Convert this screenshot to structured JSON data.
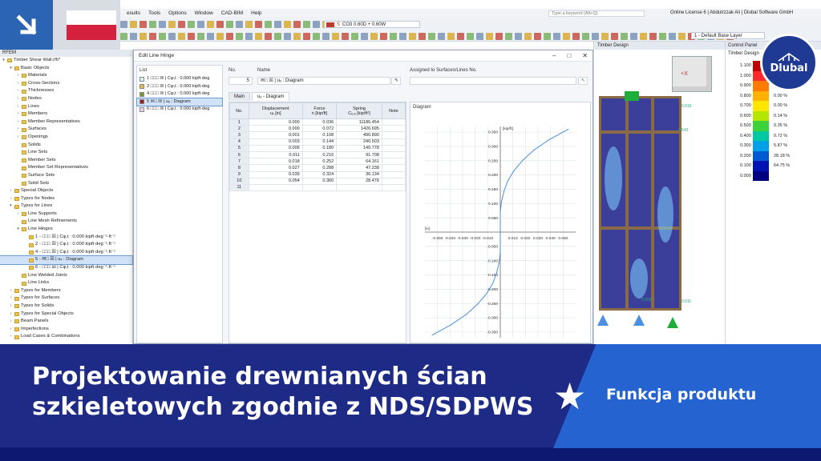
{
  "menu": [
    "esults",
    "Tools",
    "Options",
    "Window",
    "CAD-BIM",
    "Help"
  ],
  "search_placeholder": "Type a keyword (Alt+Q)",
  "license": "Online License 6 | Abdulrzzak Ali | Dlubal Software GmbH",
  "toolbar": {
    "combo": "CO3  0.60D + 0.60W",
    "combo_tag": "S",
    "layer": "1 - Default Base Layer"
  },
  "navigator": {
    "title": "RFEM",
    "items": [
      {
        "label": "Timber Shear Wall.rf6*",
        "indent": 0,
        "exp": "▾"
      },
      {
        "label": "Basic Objects",
        "indent": 1,
        "exp": "▾"
      },
      {
        "label": "Materials",
        "indent": 2,
        "exp": "›"
      },
      {
        "label": "Cross-Sections",
        "indent": 2,
        "exp": "›"
      },
      {
        "label": "Thicknesses",
        "indent": 2,
        "exp": "›"
      },
      {
        "label": "Nodes",
        "indent": 2,
        "exp": "›"
      },
      {
        "label": "Lines",
        "indent": 2,
        "exp": "›"
      },
      {
        "label": "Members",
        "indent": 2,
        "exp": "›"
      },
      {
        "label": "Member Representatives",
        "indent": 2,
        "exp": "›"
      },
      {
        "label": "Surfaces",
        "indent": 2,
        "exp": "›"
      },
      {
        "label": "Openings",
        "indent": 2,
        "exp": "›"
      },
      {
        "label": "Solids",
        "indent": 2,
        "exp": ""
      },
      {
        "label": "Line Sets",
        "indent": 2,
        "exp": ""
      },
      {
        "label": "Member Sets",
        "indent": 2,
        "exp": ""
      },
      {
        "label": "Member Set Representatives",
        "indent": 2,
        "exp": ""
      },
      {
        "label": "Surface Sets",
        "indent": 2,
        "exp": ""
      },
      {
        "label": "Solid Sets",
        "indent": 2,
        "exp": ""
      },
      {
        "label": "Special Objects",
        "indent": 1,
        "exp": "›"
      },
      {
        "label": "Types for Nodes",
        "indent": 1,
        "exp": "›"
      },
      {
        "label": "Types for Lines",
        "indent": 1,
        "exp": "▾"
      },
      {
        "label": "Line Supports",
        "indent": 2,
        "exp": "›"
      },
      {
        "label": "Line Mesh Refinements",
        "indent": 2,
        "exp": ""
      },
      {
        "label": "Line Hinges",
        "indent": 2,
        "exp": "▾"
      },
      {
        "label": "1 - □□□ ☒ | Cφ,t : 0.000 kipft·deg⁻¹·ft⁻¹",
        "indent": 3,
        "exp": ""
      },
      {
        "label": "2 - □□□ ☒ | Cφ,t : 0.000 kipft·deg⁻¹·ft⁻¹",
        "indent": 3,
        "exp": ""
      },
      {
        "label": "4 - □□□ ☒ | Cφ,t : 0.000 kipft·deg⁻¹·ft⁻¹",
        "indent": 3,
        "exp": ""
      },
      {
        "label": "5 - ✉□ ☒ | uₓ : Diagram",
        "indent": 3,
        "exp": "",
        "sel": true
      },
      {
        "label": "6 - □□□ ☒ | Cφ,t : 0.000 kipft·deg⁻¹·ft⁻¹",
        "indent": 3,
        "exp": ""
      },
      {
        "label": "Line Welded Joints",
        "indent": 2,
        "exp": ""
      },
      {
        "label": "Line Links",
        "indent": 2,
        "exp": ""
      },
      {
        "label": "Types for Members",
        "indent": 1,
        "exp": "›"
      },
      {
        "label": "Types for Surfaces",
        "indent": 1,
        "exp": "›"
      },
      {
        "label": "Types for Solids",
        "indent": 1,
        "exp": "›"
      },
      {
        "label": "Types for Special Objects",
        "indent": 1,
        "exp": "›"
      },
      {
        "label": "Beam Panels",
        "indent": 1,
        "exp": "›"
      },
      {
        "label": "Imperfections",
        "indent": 1,
        "exp": "›"
      },
      {
        "label": "Load Cases & Combinations",
        "indent": 1,
        "exp": "›"
      }
    ]
  },
  "dialog": {
    "title": "Edit Line Hinge",
    "list_label": "List",
    "list": [
      {
        "text": "1 □□□ ☒ | Cφ,t : 0.000 kipft·deg",
        "color": "#d9f3f3"
      },
      {
        "text": "2 □□□ ☒ | Cφ,t : 0.000 kipft·deg",
        "color": "#e8b64a"
      },
      {
        "text": "4 □□□ ☒ | Cφ,t : 0.000 kipft·deg",
        "color": "#7a9a2a"
      },
      {
        "text": "5 ✉□ ☒ | uₓ : Diagram",
        "color": "#9b1c1c",
        "sel": true
      },
      {
        "text": "6 □□□ ☒ | Cφ,t : 0.000 kipft·deg",
        "color": "#e8d2f0"
      }
    ],
    "no_label": "No.",
    "no_value": "5",
    "name_label": "Name",
    "name_value": "✉□ ☒ | uₓ : Diagram",
    "assigned_label": "Assigned to Surfaces/Lines No.",
    "tabs": [
      "Main",
      "uₓ - Diagram"
    ],
    "table_headers": [
      "No.",
      "Displacement\nuₓ [in]",
      "Force\nn [kip/ft]",
      "Spring\nCᵤ,ₓ [kip/ft²]",
      "Note"
    ],
    "rows": [
      [
        "1",
        "0.000",
        "0.036",
        "11186.454",
        ""
      ],
      [
        "2",
        "0.000",
        "0.072",
        "1426.695",
        ""
      ],
      [
        "3",
        "0.001",
        "0.108",
        "490.890",
        ""
      ],
      [
        "4",
        "0.003",
        "0.144",
        "240.503",
        ""
      ],
      [
        "5",
        "0.006",
        "0.180",
        "140.778",
        ""
      ],
      [
        "6",
        "0.011",
        "0.216",
        "91.708",
        ""
      ],
      [
        "7",
        "0.018",
        "0.252",
        "64.161",
        ""
      ],
      [
        "8",
        "0.027",
        "0.288",
        "47.238",
        ""
      ],
      [
        "9",
        "0.039",
        "0.324",
        "36.134",
        ""
      ],
      [
        "10",
        "0.054",
        "0.360",
        "28.476",
        ""
      ],
      [
        "11",
        "",
        "",
        "",
        ""
      ]
    ],
    "diagram_label": "Diagram"
  },
  "chart_data": {
    "type": "line",
    "title": "",
    "xlabel": "[in]",
    "ylabel": "[kip/ft]",
    "x_ticks": [
      "-0.050",
      "-0.040",
      "-0.030",
      "-0.020",
      "-0.010",
      "0.010",
      "0.020",
      "0.030",
      "0.040",
      "0.050"
    ],
    "y_ticks": [
      "0.350",
      "0.300",
      "0.250",
      "0.200",
      "0.150",
      "0.100",
      "0.050",
      "-0.050",
      "-0.100",
      "-0.150",
      "-0.200",
      "-0.250",
      "-0.300",
      "-0.350"
    ],
    "xlim": [
      -0.06,
      0.06
    ],
    "ylim": [
      -0.37,
      0.37
    ],
    "series": [
      {
        "x": [
          -0.054,
          -0.039,
          -0.027,
          -0.018,
          -0.011,
          -0.006,
          -0.003,
          -0.001,
          0.0,
          0.0,
          0.0,
          0.0,
          0.0,
          0.001,
          0.003,
          0.006,
          0.011,
          0.018,
          0.027,
          0.039,
          0.054
        ],
        "y": [
          -0.36,
          -0.324,
          -0.288,
          -0.252,
          -0.216,
          -0.18,
          -0.144,
          -0.108,
          -0.072,
          -0.036,
          0.0,
          0.036,
          0.072,
          0.108,
          0.144,
          0.18,
          0.216,
          0.252,
          0.288,
          0.324,
          0.36
        ],
        "color": "#4a90d9"
      }
    ]
  },
  "viewport": {
    "title": "Timber Design",
    "labels": [
      "0.016",
      "0.542",
      "0.006",
      "0.011"
    ]
  },
  "control_panel": {
    "title": "Control Panel",
    "subtitle": "Timber Design",
    "legend": [
      {
        "val": "1.100",
        "color": "#c00000",
        "pct": ""
      },
      {
        "val": "1.000",
        "color": "#ff2a2a",
        "pct": "0.00 %"
      },
      {
        "val": "0.900",
        "color": "#ff7a00",
        "pct": "0.00 %"
      },
      {
        "val": "0.800",
        "color": "#ffb300",
        "pct": "0.00 %"
      },
      {
        "val": "0.700",
        "color": "#ffe600",
        "pct": "0.00 %"
      },
      {
        "val": "0.600",
        "color": "#b4e600",
        "pct": "0.14 %"
      },
      {
        "val": "0.500",
        "color": "#3cd23c",
        "pct": "0.35 %"
      },
      {
        "val": "0.400",
        "color": "#00c8a0",
        "pct": "0.72 %"
      },
      {
        "val": "0.300",
        "color": "#00a0e6",
        "pct": "5.87 %"
      },
      {
        "val": "0.200",
        "color": "#005ad2",
        "pct": "28.18 %"
      },
      {
        "val": "0.100",
        "color": "#0014b4",
        "pct": "64.75 %"
      },
      {
        "val": "0.000",
        "color": "#000080",
        "pct": ""
      }
    ]
  },
  "brand": "Dlubal",
  "banner": {
    "title_line1": "Projektowanie drewnianych ścian",
    "title_line2": "szkieletowych zgodnie z NDS/SDPWS",
    "badge": "Funkcja produktu"
  }
}
